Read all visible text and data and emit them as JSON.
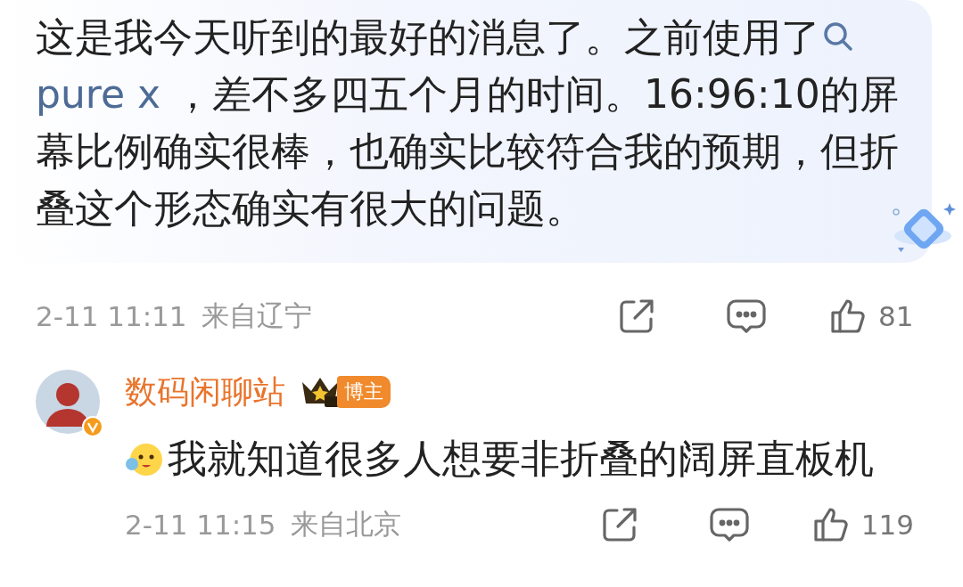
{
  "post": {
    "text_before": "这是我今天听到的最好的消息了。之前使用了",
    "link": "pure x",
    "text_after": " ，差不多四五个月的时间。16:96:10的屏幕比例确实很棒，也确实比较符合我的预期，但折叠这个形态确实有很大的问题。"
  },
  "post_meta": {
    "time": "2-11 11:11",
    "location": "来自辽宁",
    "likes": "81"
  },
  "reply": {
    "author": "数码闲聊站",
    "badge": "博主",
    "text": "我就知道很多人想要非折叠的阔屏直板机",
    "time": "2-11 11:15",
    "location": "来自北京",
    "likes": "119"
  }
}
